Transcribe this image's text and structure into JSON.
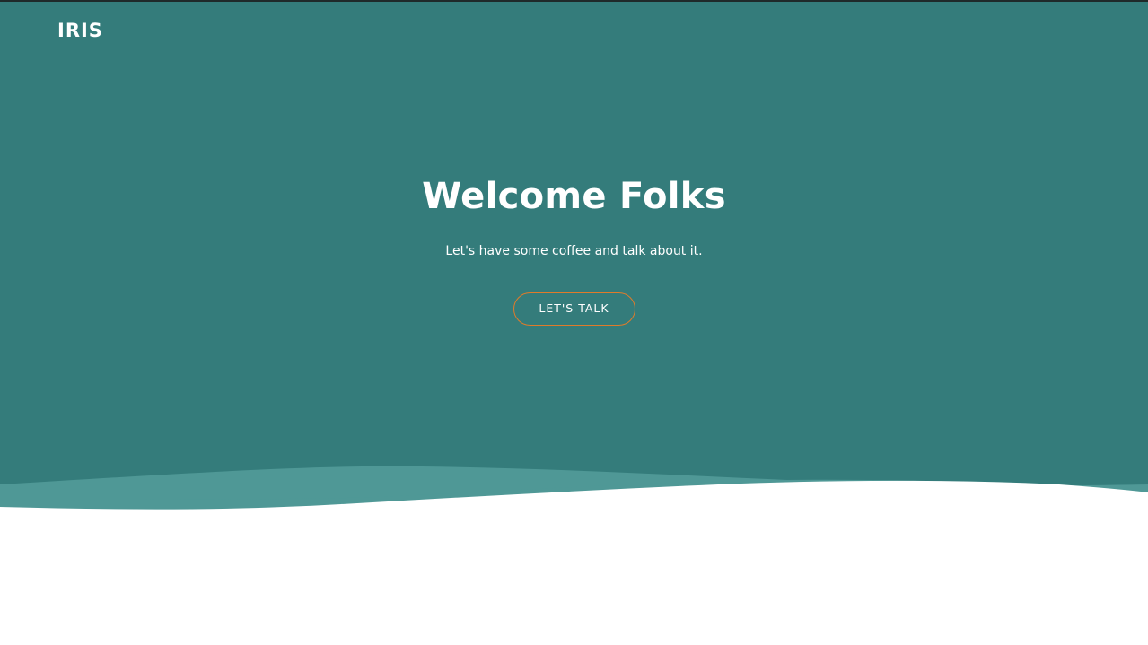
{
  "header": {
    "logo_text": "IRIS"
  },
  "hero": {
    "title": "Welcome Folks",
    "subtitle": "Let's have some coffee and talk about it.",
    "cta_label": "LET'S TALK"
  },
  "colors": {
    "hero_background": "#347c7b",
    "wave_light": "#4f9896",
    "wave_mid": "#3e8a88",
    "page_background": "#ffffff",
    "accent": "#e07b2a",
    "text": "#ffffff"
  }
}
